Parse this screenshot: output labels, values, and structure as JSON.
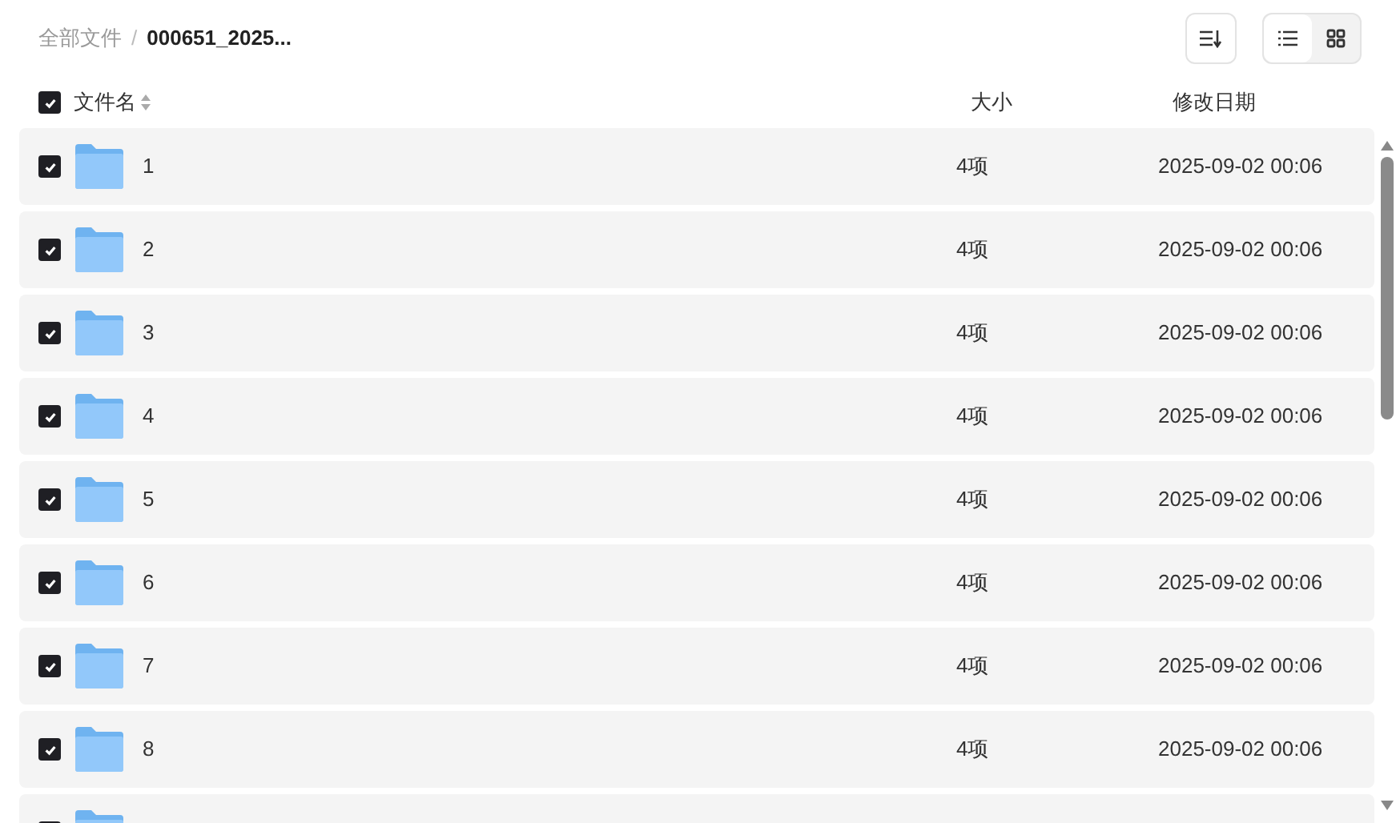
{
  "breadcrumb_separator": "/",
  "breadcrumb": [
    {
      "label": "全部文件",
      "current": false
    },
    {
      "label": "000651_2025...",
      "current": true
    }
  ],
  "view_toggle": [
    {
      "kind": "list",
      "selected": true
    },
    {
      "kind": "grid",
      "selected": false
    }
  ],
  "header": {
    "checked": true,
    "name": "文件名",
    "size": "大小",
    "date": "修改日期"
  },
  "rows": [
    {
      "checked": true,
      "name": "1",
      "size": "4项",
      "date": "2025-09-02 00:06"
    },
    {
      "checked": true,
      "name": "2",
      "size": "4项",
      "date": "2025-09-02 00:06"
    },
    {
      "checked": true,
      "name": "3",
      "size": "4项",
      "date": "2025-09-02 00:06"
    },
    {
      "checked": true,
      "name": "4",
      "size": "4项",
      "date": "2025-09-02 00:06"
    },
    {
      "checked": true,
      "name": "5",
      "size": "4项",
      "date": "2025-09-02 00:06"
    },
    {
      "checked": true,
      "name": "6",
      "size": "4项",
      "date": "2025-09-02 00:06"
    },
    {
      "checked": true,
      "name": "7",
      "size": "4项",
      "date": "2025-09-02 00:06"
    },
    {
      "checked": true,
      "name": "8",
      "size": "4项",
      "date": "2025-09-02 00:06"
    },
    {
      "checked": true
    }
  ]
}
